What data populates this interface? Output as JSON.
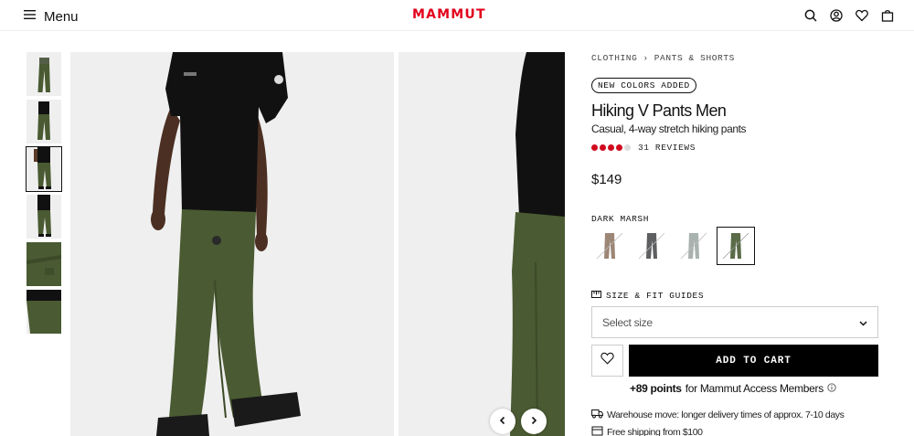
{
  "header": {
    "menu_label": "Menu",
    "logo": "MAMMUT",
    "icons": [
      "search-icon",
      "account-icon",
      "wishlist-icon",
      "bag-icon"
    ]
  },
  "gallery": {
    "thumbnail_count": 6,
    "active_thumbnail": 3,
    "nav_icons": [
      "chevron-left-icon",
      "chevron-right-icon"
    ]
  },
  "product": {
    "breadcrumb": [
      "CLOTHING",
      "PANTS & SHORTS"
    ],
    "breadcrumb_separator": "›",
    "badge": "NEW COLORS ADDED",
    "title": "Hiking V Pants Men",
    "subtitle": "Casual, 4-way stretch hiking pants",
    "rating": 4.5,
    "rating_max": 5,
    "reviews": "31 REVIEWS",
    "price": "$149",
    "color_label": "DARK MARSH",
    "swatches": [
      {
        "color": "#9c8676",
        "available": false
      },
      {
        "color": "#5d5f60",
        "available": false
      },
      {
        "color": "#a9b2ae",
        "available": false
      },
      {
        "color": "#5a6b47",
        "available": false,
        "selected": true
      }
    ],
    "size_guide_label": "SIZE & FIT GUIDES",
    "size_select_placeholder": "Select size",
    "add_to_cart_label": "ADD TO CART",
    "points_strong": "+89 points",
    "points_text": "for Mammut Access Members",
    "info_lines": [
      "Warehouse move: longer delivery times of approx. 7-10 days",
      "Free shipping from $100"
    ]
  },
  "colors": {
    "brand_red": "#e2001a",
    "rating_red": "#d10a1e",
    "pants_green": "#4a5a32",
    "shirt_black": "#111111",
    "image_background": "#efefef"
  }
}
